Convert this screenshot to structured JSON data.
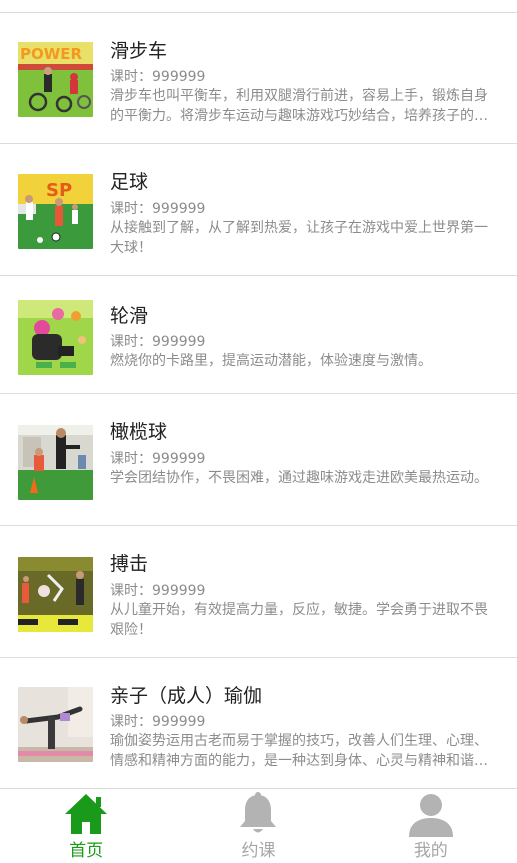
{
  "courses": [
    {
      "title": "滑步车",
      "hours": "课时：999999",
      "desc": "滑步车也叫平衡车，利用双腿滑行前进，容易上手，锻炼自身的平衡力。将滑步车运动与趣味游戏巧妙结合，培养孩子的协调能力。",
      "thumb_text": "POWER"
    },
    {
      "title": "足球",
      "hours": "课时：999999",
      "desc": "从接触到了解，从了解到热爱，让孩子在游戏中爱上世界第一大球！",
      "thumb_text": "SP"
    },
    {
      "title": "轮滑",
      "hours": "课时：999999",
      "desc": "燃烧你的卡路里，提高运动潜能，体验速度与激情。"
    },
    {
      "title": "橄榄球",
      "hours": "课时：999999",
      "desc": "学会团结协作，不畏困难，通过趣味游戏走进欧美最热运动。"
    },
    {
      "title": "搏击",
      "hours": "课时：999999",
      "desc": "从儿童开始，有效提高力量，反应，敏捷。学会勇于进取不畏艰险！"
    },
    {
      "title": "亲子（成人）瑜伽",
      "hours": "课时：999999",
      "desc": "瑜伽姿势运用古老而易于掌握的技巧，改善人们生理、心理、情感和精神方面的能力，是一种达到身体、心灵与精神和谐统一的运动方式。"
    }
  ],
  "tabbar": {
    "home": "首页",
    "booking": "约课",
    "mine": "我的"
  },
  "colors": {
    "active": "#1a9a1a",
    "inactive": "#a6a6a6",
    "divider": "#dcdcdc"
  },
  "icons": {
    "home": "home-icon",
    "booking": "bell-icon",
    "mine": "user-icon"
  }
}
